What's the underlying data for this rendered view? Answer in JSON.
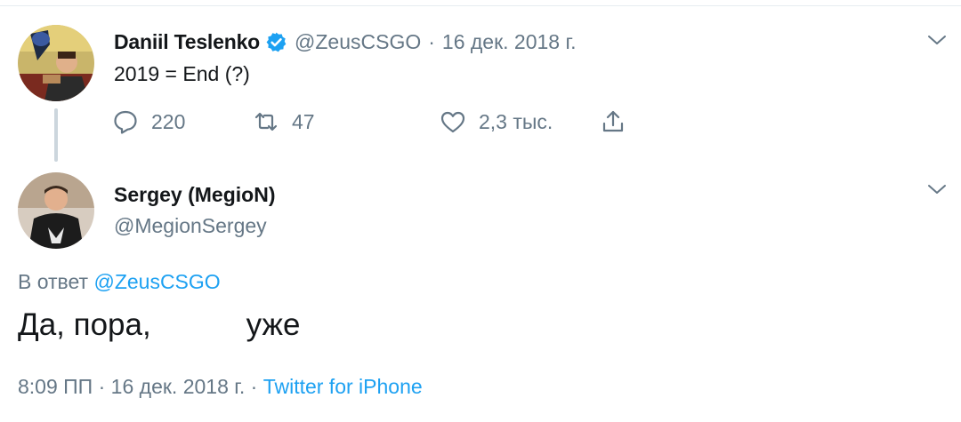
{
  "parent_tweet": {
    "author_name": "Daniil Teslenko",
    "verified": true,
    "handle": "@ZeusCSGO",
    "separator": "·",
    "date": "16 дек. 2018 г.",
    "text": "2019 = End (?)",
    "actions": {
      "reply_count": "220",
      "retweet_count": "47",
      "like_count": "2,3 тыс."
    }
  },
  "reply_tweet": {
    "author_name": "Sergey (MegioN)",
    "handle": "@MegionSergey",
    "reply_label": "В ответ",
    "reply_mention": "@ZeusCSGO",
    "text": "Да, пора,           уже",
    "time": "8:09 ПП",
    "date": "16 дек. 2018 г.",
    "separator": "·",
    "source": "Twitter for iPhone"
  },
  "icons": {
    "verified": "verified-badge-icon",
    "reply": "reply-bubble-icon",
    "retweet": "retweet-icon",
    "like": "heart-icon",
    "share": "share-icon",
    "menu": "chevron-down-icon"
  },
  "colors": {
    "accent": "#1da1f2",
    "text_primary": "#14171a",
    "text_secondary": "#657786",
    "divider": "#e6ecf0"
  }
}
